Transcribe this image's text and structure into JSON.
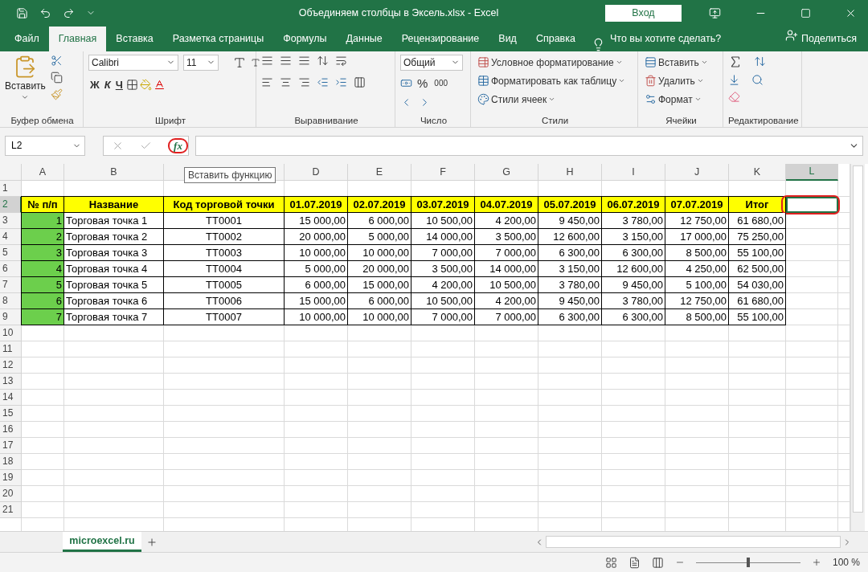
{
  "window": {
    "title": "Объединяем столбцы в Эксель.xlsx  -  Excel",
    "sign_in": "Вход"
  },
  "tabs": [
    {
      "label": "Файл",
      "selected": false
    },
    {
      "label": "Главная",
      "selected": true
    },
    {
      "label": "Вставка",
      "selected": false
    },
    {
      "label": "Разметка страницы",
      "selected": false
    },
    {
      "label": "Формулы",
      "selected": false
    },
    {
      "label": "Данные",
      "selected": false
    },
    {
      "label": "Рецензирование",
      "selected": false
    },
    {
      "label": "Вид",
      "selected": false
    },
    {
      "label": "Справка",
      "selected": false
    }
  ],
  "tell_me": "Что вы хотите сделать?",
  "share": "Поделиться",
  "ribbon": {
    "clipboard": {
      "paste": "Вставить",
      "label": "Буфер обмена"
    },
    "font": {
      "name": "Calibri",
      "size": "11",
      "bold": "Ж",
      "italic": "К",
      "underline": "Ч",
      "label": "Шрифт"
    },
    "alignment": {
      "label": "Выравнивание"
    },
    "number": {
      "format": "Общий",
      "percent": "%",
      "thousands": "000",
      "label": "Число"
    },
    "styles": {
      "items": [
        "Условное форматирование",
        "Форматировать как таблицу",
        "Стили ячеек"
      ],
      "label": "Стили"
    },
    "cells": {
      "items": [
        "Вставить",
        "Удалить",
        "Формат"
      ],
      "label": "Ячейки"
    },
    "editing": {
      "label": "Редактирование"
    }
  },
  "name_box": "L2",
  "insert_function": "fx",
  "tooltip": "Вставить функцию",
  "columns": [
    {
      "label": "A",
      "selected": false
    },
    {
      "label": "B",
      "selected": false
    },
    {
      "selected": false
    },
    {
      "label": "D",
      "selected": false
    },
    {
      "label": "E",
      "selected": false
    },
    {
      "label": "F",
      "selected": false
    },
    {
      "label": "G",
      "selected": false
    },
    {
      "label": "H",
      "selected": false
    },
    {
      "label": "I",
      "selected": false
    },
    {
      "label": "J",
      "selected": false
    },
    {
      "label": "K",
      "selected": false
    },
    {
      "label": "L",
      "selected": true
    }
  ],
  "row_numbers": [
    {
      "label": "1",
      "selected": false
    },
    {
      "label": "2",
      "selected": true
    },
    {
      "label": "3",
      "selected": false
    },
    {
      "label": "4",
      "selected": false
    },
    {
      "label": "5",
      "selected": false
    },
    {
      "label": "6",
      "selected": false
    },
    {
      "label": "7",
      "selected": false
    },
    {
      "label": "8",
      "selected": false
    },
    {
      "label": "9",
      "selected": false
    },
    {
      "label": "10",
      "selected": false
    },
    {
      "label": "11",
      "selected": false
    },
    {
      "label": "12",
      "selected": false
    },
    {
      "label": "13",
      "selected": false
    },
    {
      "label": "14",
      "selected": false
    },
    {
      "label": "15",
      "selected": false
    },
    {
      "label": "16",
      "selected": false
    },
    {
      "label": "17",
      "selected": false
    },
    {
      "label": "18",
      "selected": false
    },
    {
      "label": "19",
      "selected": false
    },
    {
      "label": "20",
      "selected": false
    },
    {
      "label": "21",
      "selected": false
    }
  ],
  "table": {
    "header": [
      "№ п/п",
      "Название",
      "Код торговой точки",
      "01.07.2019",
      "02.07.2019",
      "03.07.2019",
      "04.07.2019",
      "05.07.2019",
      "06.07.2019",
      "07.07.2019",
      "Итог"
    ],
    "rows": [
      [
        "1",
        "Торговая точка 1",
        "ТТ0001",
        "15 000,00",
        "6 000,00",
        "10 500,00",
        "4 200,00",
        "9 450,00",
        "3 780,00",
        "12 750,00",
        "61 680,00"
      ],
      [
        "2",
        "Торговая точка 2",
        "ТТ0002",
        "20 000,00",
        "5 000,00",
        "14 000,00",
        "3 500,00",
        "12 600,00",
        "3 150,00",
        "17 000,00",
        "75 250,00"
      ],
      [
        "3",
        "Торговая точка 3",
        "ТТ0003",
        "10 000,00",
        "10 000,00",
        "7 000,00",
        "7 000,00",
        "6 300,00",
        "6 300,00",
        "8 500,00",
        "55 100,00"
      ],
      [
        "4",
        "Торговая точка 4",
        "ТТ0004",
        "5 000,00",
        "20 000,00",
        "3 500,00",
        "14 000,00",
        "3 150,00",
        "12 600,00",
        "4 250,00",
        "62 500,00"
      ],
      [
        "5",
        "Торговая точка 5",
        "ТТ0005",
        "6 000,00",
        "15 000,00",
        "4 200,00",
        "10 500,00",
        "3 780,00",
        "9 450,00",
        "5 100,00",
        "54 030,00"
      ],
      [
        "6",
        "Торговая точка 6",
        "ТТ0006",
        "15 000,00",
        "6 000,00",
        "10 500,00",
        "4 200,00",
        "9 450,00",
        "3 780,00",
        "12 750,00",
        "61 680,00"
      ],
      [
        "7",
        "Торговая точка 7",
        "ТТ0007",
        "10 000,00",
        "10 000,00",
        "7 000,00",
        "7 000,00",
        "6 300,00",
        "6 300,00",
        "8 500,00",
        "55 100,00"
      ]
    ]
  },
  "sheet_tabs": [
    {
      "label": "microexcel.ru",
      "selected": true
    }
  ],
  "zoom_slider": {
    "level": 0.5
  },
  "zoom": "100 %"
}
